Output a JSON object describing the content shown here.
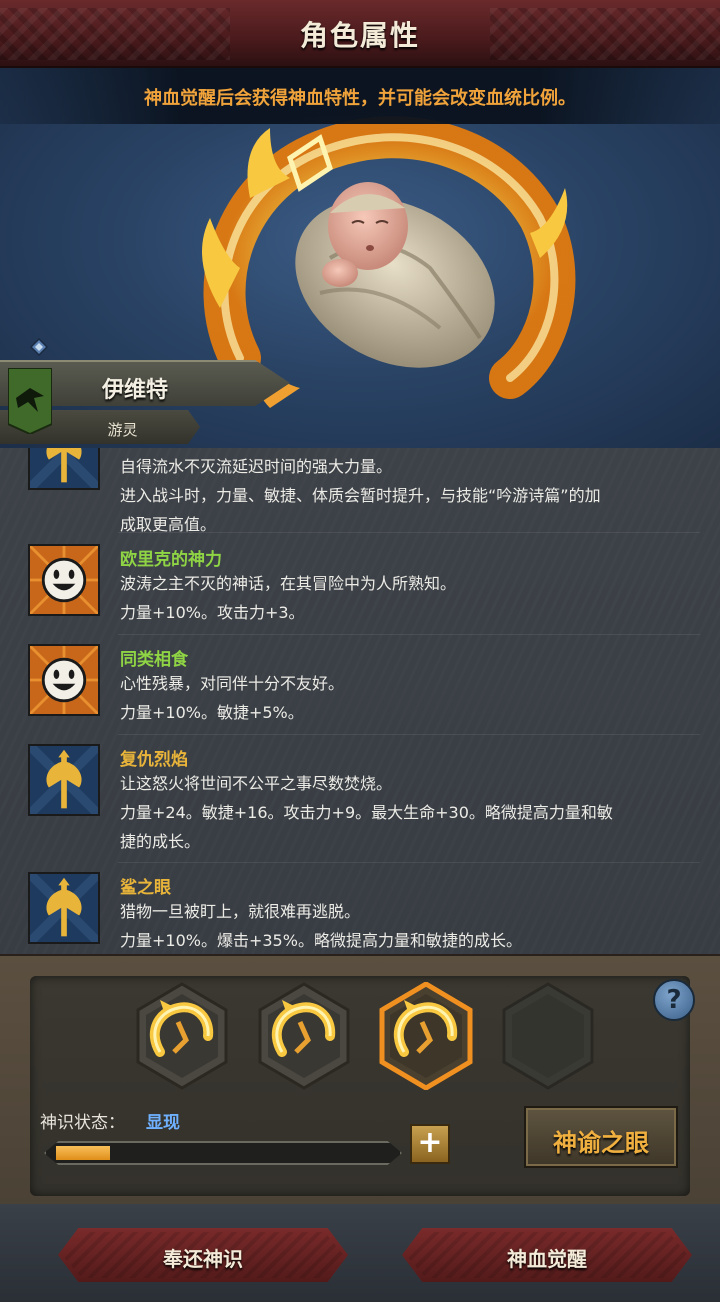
{
  "header": {
    "title": "角色属性"
  },
  "subtitle": "神血觉醒后会获得神血特性，并可能会改变血统比例。",
  "character": {
    "name": "伊维特",
    "class": "游灵"
  },
  "traits": [
    {
      "name": "",
      "icon": "axe-icon",
      "partial_line": "自得流水不灭流延迟时间的强大力量。",
      "desc": [
        "进入战斗时，力量、敏捷、体质会暂时提升，与技能“吟游诗篇”的加",
        "成取更高值。"
      ]
    },
    {
      "name": "欧里克的神力",
      "name_color": "green",
      "icon": "smiley-icon",
      "desc": [
        "波涛之主不灭的神话，在其冒险中为人所熟知。",
        "力量+10%。攻击力+3。"
      ]
    },
    {
      "name": "同类相食",
      "name_color": "green",
      "icon": "smiley-icon",
      "desc": [
        "心性残暴，对同伴十分不友好。",
        "力量+10%。敏捷+5%。"
      ]
    },
    {
      "name": "复仇烈焰",
      "name_color": "gold",
      "icon": "axe-icon",
      "desc": [
        "让这怒火将世间不公平之事尽数焚烧。",
        "力量+24。敏捷+16。攻击力+9。最大生命+30。略微提高力量和敏",
        "捷的成长。"
      ]
    },
    {
      "name": "鲨之眼",
      "name_color": "gold",
      "icon": "axe-icon",
      "desc": [
        "猎物一旦被盯上，就很难再逃脱。",
        "力量+10%。爆击+35%。略微提高力量和敏捷的成长。"
      ]
    }
  ],
  "slots": [
    {
      "state": "filled",
      "icon": "flame-ring-icon"
    },
    {
      "state": "filled",
      "icon": "flame-ring-icon"
    },
    {
      "state": "selected",
      "icon": "flame-ring-icon"
    },
    {
      "state": "empty",
      "icon": ""
    }
  ],
  "help": {
    "label": "?"
  },
  "status": {
    "label": "神识状态：",
    "value": "显现",
    "progress": 0.16
  },
  "plus_label": "+",
  "oracle_button": "神谕之眼",
  "footer": {
    "left_button": "奉还神识",
    "right_button": "神血觉醒"
  },
  "colors": {
    "accent": "#f0a33a",
    "green": "#8fd444",
    "gold": "#e8b43a",
    "blue": "#6fb0ff"
  }
}
